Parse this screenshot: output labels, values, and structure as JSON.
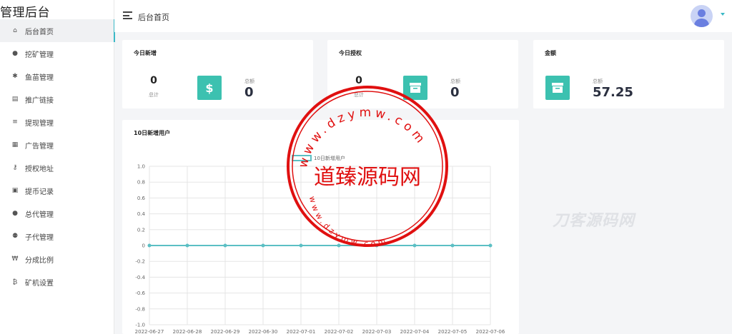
{
  "sidebar": {
    "title": "管理后台",
    "items": [
      {
        "label": "后台首页",
        "icon": "home-icon",
        "glyph": "⌂"
      },
      {
        "label": "挖矿管理",
        "icon": "user-icon",
        "glyph": "●"
      },
      {
        "label": "鱼苗管理",
        "icon": "bug-icon",
        "glyph": "✱"
      },
      {
        "label": "推广链接",
        "icon": "document-icon",
        "glyph": "▤"
      },
      {
        "label": "提现管理",
        "icon": "list-icon",
        "glyph": "≡"
      },
      {
        "label": "广告管理",
        "icon": "grid-icon",
        "glyph": "▦"
      },
      {
        "label": "授权地址",
        "icon": "key-icon",
        "glyph": "⚷"
      },
      {
        "label": "提币记录",
        "icon": "record-icon",
        "glyph": "▣"
      },
      {
        "label": "总代管理",
        "icon": "user-icon",
        "glyph": "●"
      },
      {
        "label": "子代管理",
        "icon": "users-icon",
        "glyph": "⚉"
      },
      {
        "label": "分成比例",
        "icon": "won-icon",
        "glyph": "₩"
      },
      {
        "label": "矿机设置",
        "icon": "bitcoin-icon",
        "glyph": "₿"
      }
    ]
  },
  "header": {
    "title": "后台首页"
  },
  "cards": {
    "today_new": {
      "title": "今日新增",
      "count": "0",
      "count_label": "总计",
      "total_label": "总额",
      "total": "0",
      "icon": "dollar-icon",
      "glyph": "$"
    },
    "today_auth": {
      "title": "今日授权",
      "count": "0",
      "count_label": "总计",
      "total_label": "总额",
      "total": "0",
      "icon": "archive-icon"
    },
    "amount": {
      "title": "金额",
      "total_label": "总额",
      "total": "57.25",
      "icon": "archive-icon"
    }
  },
  "colors": {
    "accent": "#3bb9c6",
    "icon_bg": "#3cc1b0",
    "line": "#5bbfc4"
  },
  "chart_data": {
    "type": "line",
    "title": "10日新增用户",
    "legend": "10日新增用户",
    "x": [
      "2022-06-27",
      "2022-06-28",
      "2022-06-29",
      "2022-06-30",
      "2022-07-01",
      "2022-07-02",
      "2022-07-03",
      "2022-07-04",
      "2022-07-05",
      "2022-07-06"
    ],
    "series": [
      {
        "name": "10日新增用户",
        "values": [
          0,
          0,
          0,
          0,
          0,
          0,
          0,
          0,
          0,
          0
        ]
      }
    ],
    "ylim": [
      -1.0,
      1.0
    ],
    "yticks": [
      "1.0",
      "0.8",
      "0.6",
      "0.4",
      "0.2",
      "0",
      "-0.2",
      "-0.4",
      "-0.6",
      "-0.8",
      "-1.0"
    ],
    "grid": true,
    "legend_position": "top-center"
  },
  "watermarks": {
    "stamp_center": "道臻源码网",
    "stamp_ring_top": "www.dzymw.com",
    "stamp_ring_bottom": "www.dzymw.com",
    "brand": "刀客源码网"
  }
}
